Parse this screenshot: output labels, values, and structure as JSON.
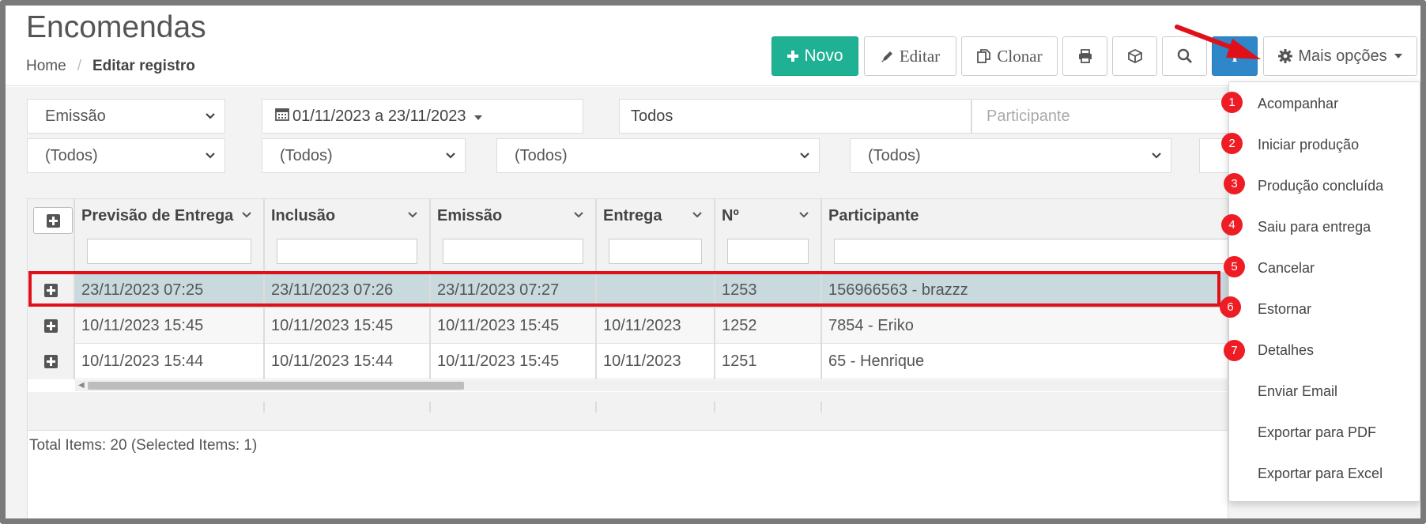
{
  "header": {
    "title": "Encomendas"
  },
  "breadcrumb": {
    "home": "Home",
    "separator": "/",
    "current": "Editar registro"
  },
  "toolbar": {
    "novo": "Novo",
    "editar": "Editar",
    "clonar": "Clonar",
    "info": "i",
    "mais": "Mais opções",
    "accent_green": "#1fb193",
    "accent_blue": "#2e87c8"
  },
  "filters": {
    "date_type": "Emissão",
    "date_range": "01/11/2023 a 23/11/2023",
    "status": "Todos",
    "participante_placeholder": "Participante",
    "selects": [
      "(Todos)",
      "(Todos)",
      "(Todos)",
      "(Todos)"
    ]
  },
  "grid": {
    "columns": [
      "Previsão de Entrega",
      "Inclusão",
      "Emissão",
      "Entrega",
      "Nº",
      "Participante"
    ],
    "rows": [
      [
        "23/11/2023 07:25",
        "23/11/2023 07:26",
        "23/11/2023 07:27",
        "",
        "1253",
        "156966563 - brazzz"
      ],
      [
        "10/11/2023 15:45",
        "10/11/2023 15:45",
        "10/11/2023 15:45",
        "10/11/2023",
        "1252",
        "7854 - Eriko"
      ],
      [
        "10/11/2023 15:44",
        "10/11/2023 15:44",
        "10/11/2023 15:45",
        "10/11/2023",
        "1251",
        "65 - Henrique"
      ]
    ],
    "selected_row": 0,
    "footer": "Total Items: 20 (Selected Items: 1)"
  },
  "menu": {
    "items": [
      {
        "badge": "1",
        "label": "Acompanhar"
      },
      {
        "badge": "2",
        "label": "Iniciar produção"
      },
      {
        "badge": "3",
        "label": "Produção concluída"
      },
      {
        "badge": "4",
        "label": "Saiu para entrega"
      },
      {
        "badge": "5",
        "label": "Cancelar"
      },
      {
        "badge": "6",
        "label": "Estornar"
      },
      {
        "badge": "7",
        "label": "Detalhes"
      },
      {
        "badge": "",
        "label": "Enviar Email"
      },
      {
        "badge": "",
        "label": "Exportar para PDF"
      },
      {
        "badge": "",
        "label": "Exportar para Excel"
      }
    ],
    "badge_color": "#ee1c24"
  },
  "annotations": {
    "highlight_color": "#e0101a"
  }
}
